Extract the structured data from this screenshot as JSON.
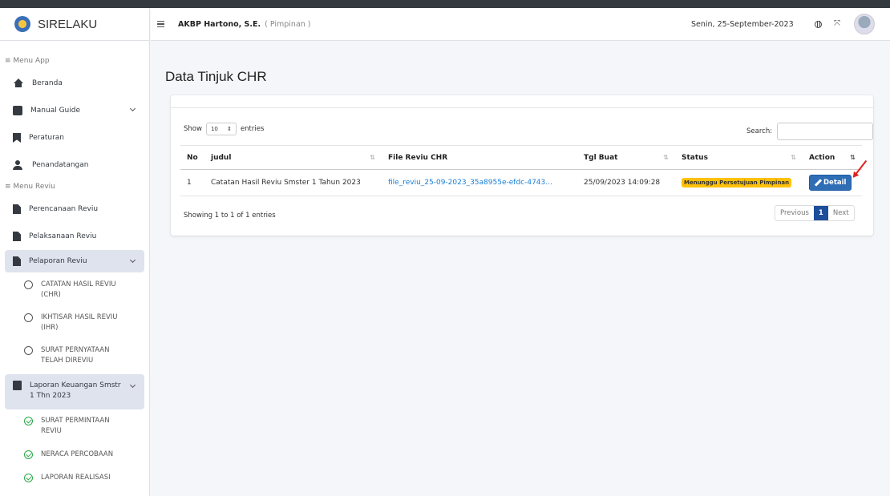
{
  "app": {
    "name": "SIRELAKU"
  },
  "header": {
    "user_name": "AKBP Hartono, S.E.",
    "user_role": "( Pimpinan )",
    "date": "Senin, 25-September-2023"
  },
  "sidebar": {
    "section_app": "≡ Menu App",
    "section_reviu": "≡ Menu Reviu",
    "items": {
      "beranda": "Beranda",
      "manual_guide": "Manual Guide",
      "peraturan": "Peraturan",
      "penandatangan": "Penandatangan",
      "perencanaan": "Perencanaan Reviu",
      "pelaksanaan": "Pelaksanaan Reviu",
      "pelaporan": "Pelaporan Reviu",
      "laporan_keuangan": "Laporan Keuangan Smstr 1 Thn 2023"
    },
    "pelaporan_sub": [
      "CATATAN HASIL REVIU (CHR)",
      "IKHTISAR HASIL REVIU (IHR)",
      "SURAT PERNYATAAN TELAH DIREVIU"
    ],
    "laporan_sub": [
      "SURAT PERMINTAAN REVIU",
      "NERACA PERCOBAAN",
      "LAPORAN REALISASI"
    ]
  },
  "main": {
    "title": "Data Tinjuk CHR",
    "show_label": "Show",
    "entries_value": "10",
    "entries_label": "entries",
    "search_label": "Search:",
    "columns": [
      "No",
      "judul",
      "File Reviu CHR",
      "Tgl Buat",
      "Status",
      "Action"
    ],
    "rows": [
      {
        "no": "1",
        "judul": "Catatan Hasil Reviu Smster 1 Tahun 2023",
        "file": "file_reviu_25-09-2023_35a8955e-efdc-4743...",
        "tgl": "25/09/2023 14:09:28",
        "status": "Menunggu Persetujuan Pimpinan",
        "action": "Detail"
      }
    ],
    "info": "Showing 1 to 1 of 1 entries",
    "pagination": {
      "previous": "Previous",
      "current": "1",
      "next": "Next"
    }
  }
}
